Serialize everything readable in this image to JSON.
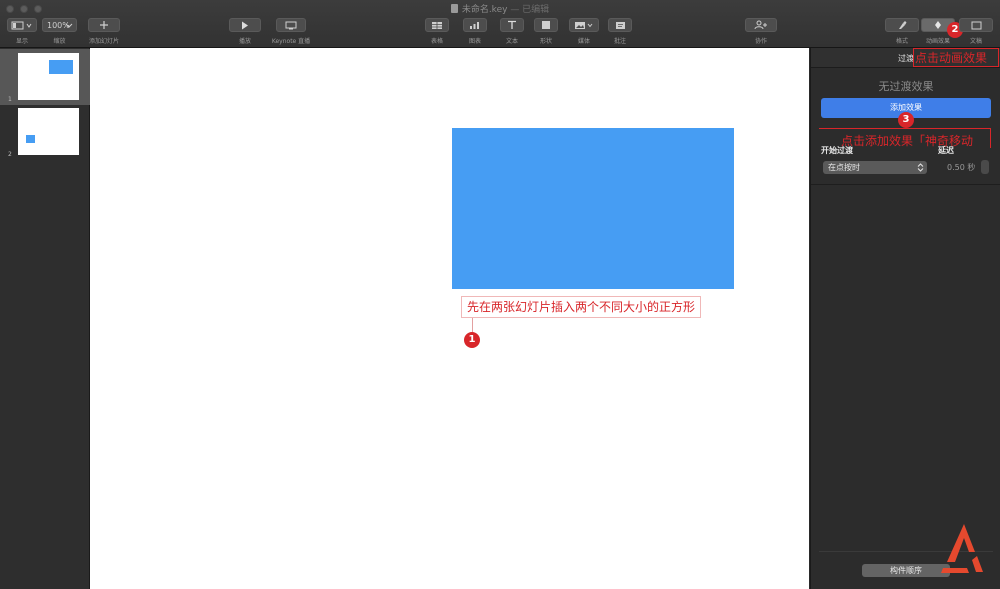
{
  "window": {
    "title": "未命名.key",
    "edited": "— 已编辑"
  },
  "toolbar": {
    "view_label": "显示",
    "zoom_value": "100%",
    "zoom_label": "缩放",
    "add_slide_label": "添加幻灯片",
    "play_label": "播放",
    "keynote_live_label": "Keynote 直播",
    "table_label": "表格",
    "chart_label": "图表",
    "text_label": "文本",
    "shape_label": "形状",
    "media_label": "媒体",
    "comment_label": "批注",
    "collaborate_label": "协作",
    "format_label": "格式",
    "animate_label": "动画效果",
    "document_label": "文稿"
  },
  "navigator": {
    "slides": [
      {
        "number": "1"
      },
      {
        "number": "2"
      }
    ]
  },
  "canvas": {
    "shape_color": "#469df3",
    "callout_1_text": "先在两张幻灯片插入两个不同大小的正方形",
    "badge_1": "1"
  },
  "inspector": {
    "tab_label": "过渡",
    "callout_2_text": "点击动画效果",
    "badge_2": "2",
    "no_effect_text": "无过渡效果",
    "add_effect_label": "添加效果",
    "badge_3": "3",
    "callout_3_text": "点击添加效果「神奇移动",
    "start_transition_label": "开始过渡",
    "delay_label": "延迟",
    "start_option": "在点按时",
    "delay_value": "0.50 秒",
    "build_order_label": "构件顺序"
  },
  "colors": {
    "accent_blue": "#3f7ee8",
    "annotation_red": "#d8262a",
    "logo_red": "#e5492e"
  },
  "icons": [
    "view-icon",
    "chevron-down-icon",
    "plus-icon",
    "play-icon",
    "keynote-live-icon",
    "table-icon",
    "chart-icon",
    "text-icon",
    "shape-icon",
    "media-icon",
    "comment-icon",
    "collaborate-icon",
    "format-brush-icon",
    "animate-diamond-icon",
    "document-icon",
    "brand-logo"
  ]
}
